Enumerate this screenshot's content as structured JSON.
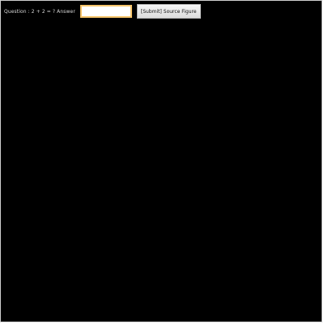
{
  "question": {
    "text": "Question : 2 + 2 = ? Answer"
  },
  "answer_input": {
    "value": "",
    "placeholder": ""
  },
  "submit_button": {
    "label": "[Submit] Source Figure"
  },
  "colors": {
    "canvas_background": "#000000",
    "input_border": "#f5c46b",
    "button_background": "#e8e8e8",
    "text": "#d9d9d9"
  }
}
